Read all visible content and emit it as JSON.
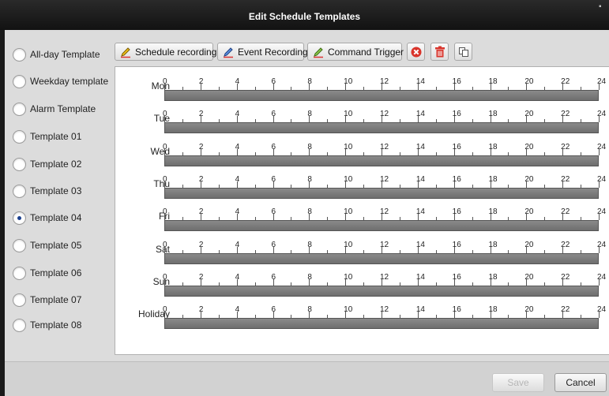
{
  "window": {
    "title": "Edit Schedule Templates"
  },
  "templates": [
    {
      "label": "All-day Template",
      "checked": false
    },
    {
      "label": "Weekday template",
      "checked": false
    },
    {
      "label": "Alarm Template",
      "checked": false
    },
    {
      "label": "Template 01",
      "checked": false
    },
    {
      "label": "Template 02",
      "checked": false
    },
    {
      "label": "Template 03",
      "checked": false
    },
    {
      "label": "Template 04",
      "checked": true
    },
    {
      "label": "Template 05",
      "checked": false
    },
    {
      "label": "Template 06",
      "checked": false
    },
    {
      "label": "Template 07",
      "checked": false
    },
    {
      "label": "Template 08",
      "checked": false
    }
  ],
  "toolbar": {
    "schedule_recording": "Schedule recording",
    "event_recording": "Event Recording",
    "command_trigger": "Command Trigger",
    "icons": [
      "pencil-yellow-icon",
      "pencil-blue-icon",
      "pencil-green-icon",
      "delete-icon",
      "trash-icon",
      "copy-icon"
    ]
  },
  "schedule": {
    "days": [
      "Mon",
      "Tue",
      "Wed",
      "Thu",
      "Fri",
      "Sat",
      "Sun",
      "Holiday"
    ],
    "hour_labels": [
      "0",
      "2",
      "4",
      "6",
      "8",
      "10",
      "12",
      "14",
      "16",
      "18",
      "20",
      "22",
      "24"
    ]
  },
  "buttons": {
    "save": "Save",
    "cancel": "Cancel",
    "save_enabled": false
  },
  "colors": {
    "titlebar": "#1a1a1a",
    "bar": "#7a7a7a",
    "delete_red": "#d9342b",
    "radio_selected": "#1a3f8f"
  }
}
